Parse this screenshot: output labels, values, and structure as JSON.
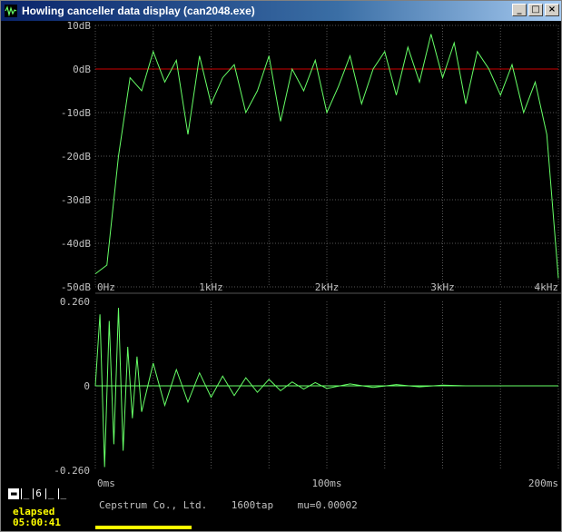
{
  "window": {
    "title": "Howling canceller data display (can2048.exe)",
    "buttons": {
      "minimize": "_",
      "maximize": "□",
      "close": "×"
    }
  },
  "spectrum": {
    "y_ticks": [
      "10dB",
      "0dB",
      "-10dB",
      "-20dB",
      "-30dB",
      "-40dB",
      "-50dB"
    ],
    "x_ticks": [
      "0Hz",
      "1kHz",
      "2kHz",
      "3kHz",
      "4kHz"
    ]
  },
  "cepstrum": {
    "y_ticks": [
      "0.260",
      "0",
      "-0.260"
    ],
    "x_ticks": [
      "0ms",
      "100ms",
      "200ms"
    ]
  },
  "controls": {
    "mini_buttons": [
      "▬",
      "_",
      "6",
      "_",
      "_"
    ]
  },
  "elapsed": {
    "label": "elapsed",
    "value": "05:00:41"
  },
  "status": {
    "company": "Cepstrum Co., Ltd.",
    "taps": "1600tap",
    "mu": "mu=0.00002"
  },
  "colors": {
    "trace": "#66ff66",
    "zero_line": "#cc0000",
    "grid": "#555555",
    "text": "#c0c0c0",
    "elapsed": "#ffff00"
  },
  "chart_data": [
    {
      "type": "line",
      "xlim": [
        0,
        4000
      ],
      "ylim": [
        -50,
        10
      ],
      "x_tick_labels": [
        "0Hz",
        "1kHz",
        "2kHz",
        "3kHz",
        "4kHz"
      ],
      "y_tick_labels": [
        "10dB",
        "0dB",
        "-10dB",
        "-20dB",
        "-30dB",
        "-40dB",
        "-50dB"
      ],
      "series": [
        {
          "x": [
            0,
            100,
            200,
            300,
            400,
            500,
            600,
            700,
            800,
            900,
            1000,
            1100,
            1200,
            1300,
            1400,
            1500,
            1600,
            1700,
            1800,
            1900,
            2000,
            2100,
            2200,
            2300,
            2400,
            2500,
            2600,
            2700,
            2800,
            2900,
            3000,
            3100,
            3200,
            3300,
            3400,
            3500,
            3600,
            3700,
            3800,
            3900,
            4000
          ],
          "y": [
            -47,
            -45,
            -20,
            -2,
            -5,
            4,
            -3,
            2,
            -15,
            3,
            -8,
            -2,
            1,
            -10,
            -5,
            3,
            -12,
            0,
            -5,
            2,
            -10,
            -4,
            3,
            -8,
            0,
            4,
            -6,
            5,
            -3,
            8,
            -2,
            6,
            -8,
            4,
            0,
            -6,
            1,
            -10,
            -3,
            -15,
            -48
          ]
        }
      ]
    },
    {
      "type": "line",
      "xlim": [
        0,
        200
      ],
      "ylim": [
        -0.26,
        0.26
      ],
      "x_tick_labels": [
        "0ms",
        "100ms",
        "200ms"
      ],
      "y_tick_labels": [
        "0.260",
        "0",
        "-0.260"
      ],
      "series": [
        {
          "x": [
            0,
            2,
            4,
            6,
            8,
            10,
            12,
            14,
            16,
            18,
            20,
            25,
            30,
            35,
            40,
            45,
            50,
            55,
            60,
            65,
            70,
            75,
            80,
            85,
            90,
            95,
            100,
            110,
            120,
            130,
            140,
            150,
            160,
            170,
            180,
            190,
            200
          ],
          "y": [
            0,
            0.22,
            -0.25,
            0.2,
            -0.18,
            0.24,
            -0.2,
            0.12,
            -0.1,
            0.09,
            -0.08,
            0.07,
            -0.06,
            0.05,
            -0.05,
            0.04,
            -0.035,
            0.03,
            -0.03,
            0.025,
            -0.02,
            0.02,
            -0.015,
            0.012,
            -0.01,
            0.01,
            -0.008,
            0.006,
            -0.005,
            0.004,
            -0.003,
            0.002,
            0,
            0,
            0,
            0,
            0
          ]
        }
      ]
    }
  ]
}
